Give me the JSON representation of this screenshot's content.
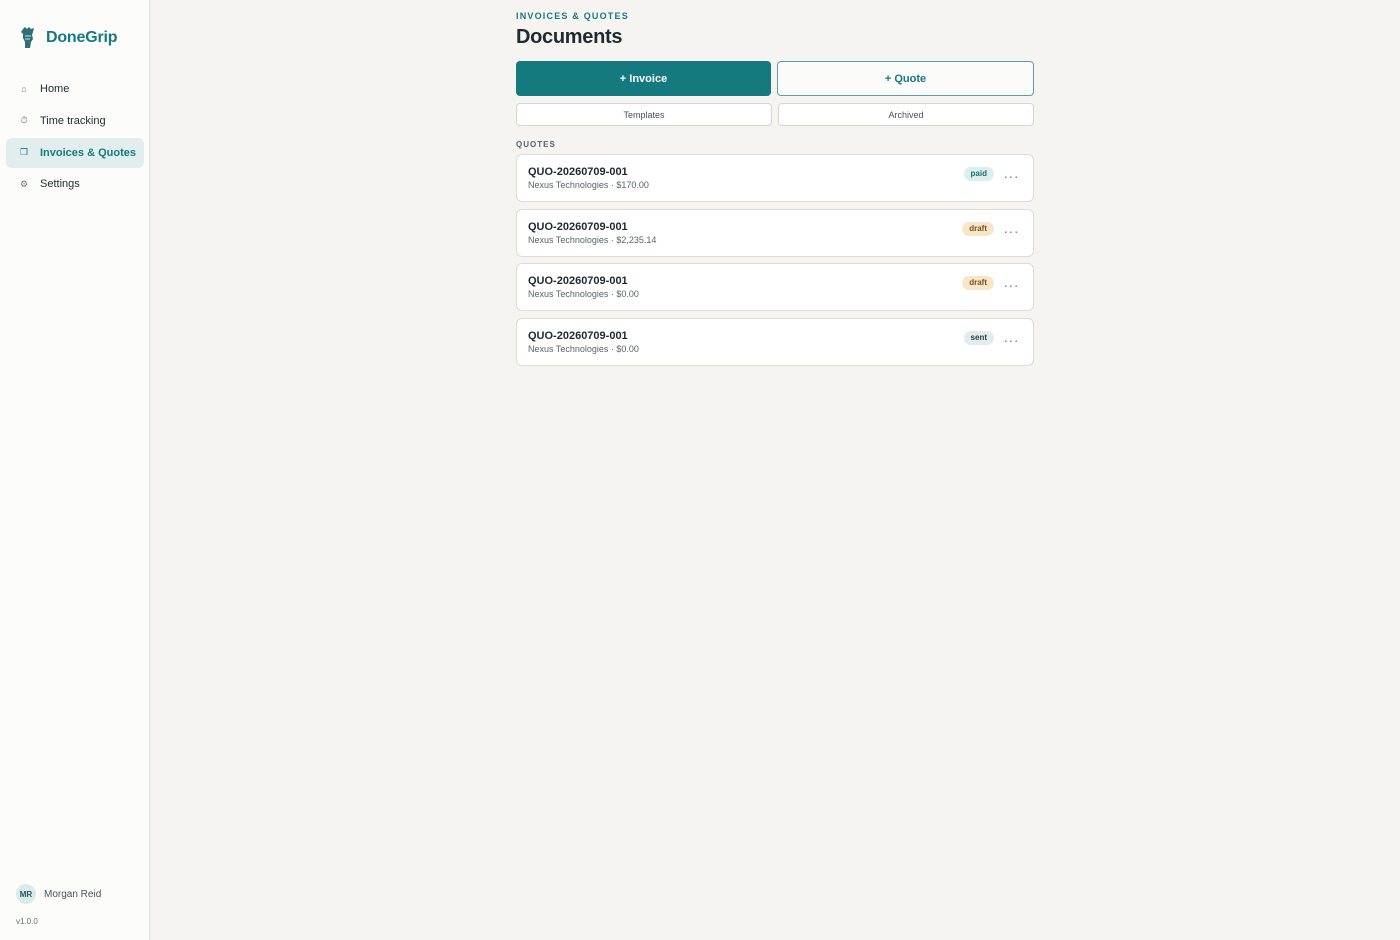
{
  "sidebar": {
    "brand": "DoneGrip",
    "nav": [
      {
        "label": "Home",
        "icon": "home-icon",
        "glyph": "⌂"
      },
      {
        "label": "Time tracking",
        "icon": "clock-icon",
        "glyph": "⏱"
      },
      {
        "label": "Invoices & Quotes",
        "icon": "documents-icon",
        "glyph": "❐"
      },
      {
        "label": "Settings",
        "icon": "gear-icon",
        "glyph": "⚙"
      }
    ],
    "active_index": 2,
    "user": {
      "initials": "MR",
      "name": "Morgan Reid"
    },
    "version": "v1.0.0"
  },
  "header": {
    "eyebrow": "INVOICES & QUOTES",
    "title": "Documents"
  },
  "actions": {
    "invoice": "+ Invoice",
    "quote": "+ Quote",
    "templates": "Templates",
    "archived": "Archived"
  },
  "quotes": {
    "label": "QUOTES",
    "items": [
      {
        "number": "QUO-20260709-001",
        "meta": "Nexus Technologies · $170.00",
        "status": "paid"
      },
      {
        "number": "QUO-20260709-001",
        "meta": "Nexus Technologies · $2,235.14",
        "status": "draft"
      },
      {
        "number": "QUO-20260709-001",
        "meta": "Nexus Technologies · $0.00",
        "status": "draft"
      },
      {
        "number": "QUO-20260709-001",
        "meta": "Nexus Technologies · $0.00",
        "status": "sent"
      }
    ]
  },
  "colors": {
    "accent": "#147a80",
    "paid": "#dcefee",
    "draft": "#f8e6c8",
    "sent": "#e3ecec"
  }
}
